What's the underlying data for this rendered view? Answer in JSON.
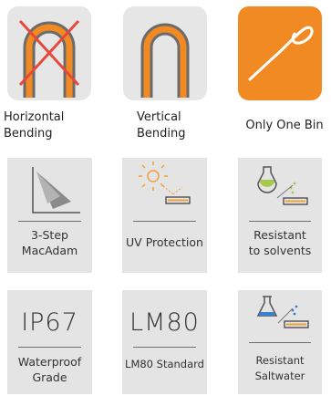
{
  "top_row": [
    {
      "label_line1": "Horizontal",
      "label_line2": "Bending"
    },
    {
      "label_line1": "Vertical",
      "label_line2": "Bending"
    },
    {
      "label": "Only One Bin"
    }
  ],
  "cards": [
    {
      "label_line1": "3-Step",
      "label_line2": "MacAdam"
    },
    {
      "label": "UV Protection"
    },
    {
      "label_line1": "Resistant",
      "label_line2": "to solvents"
    },
    {
      "code": "IP67",
      "label_line1": "Waterproof",
      "label_line2": "Grade"
    },
    {
      "code": "LM80",
      "label": "LM80 Standard"
    },
    {
      "label_line1": "Resistant",
      "label_line2": "Saltwater"
    }
  ],
  "colors": {
    "accent": "#f18a22",
    "cross": "#e8483c",
    "tile_gray": "#e6e6e6"
  },
  "icons": [
    "horizontal-bend-crossed-icon",
    "vertical-bend-icon",
    "bin-curve-icon",
    "macadam-chart-icon",
    "sun-uv-icon",
    "solvent-flask-icon",
    "saltwater-flask-icon"
  ]
}
